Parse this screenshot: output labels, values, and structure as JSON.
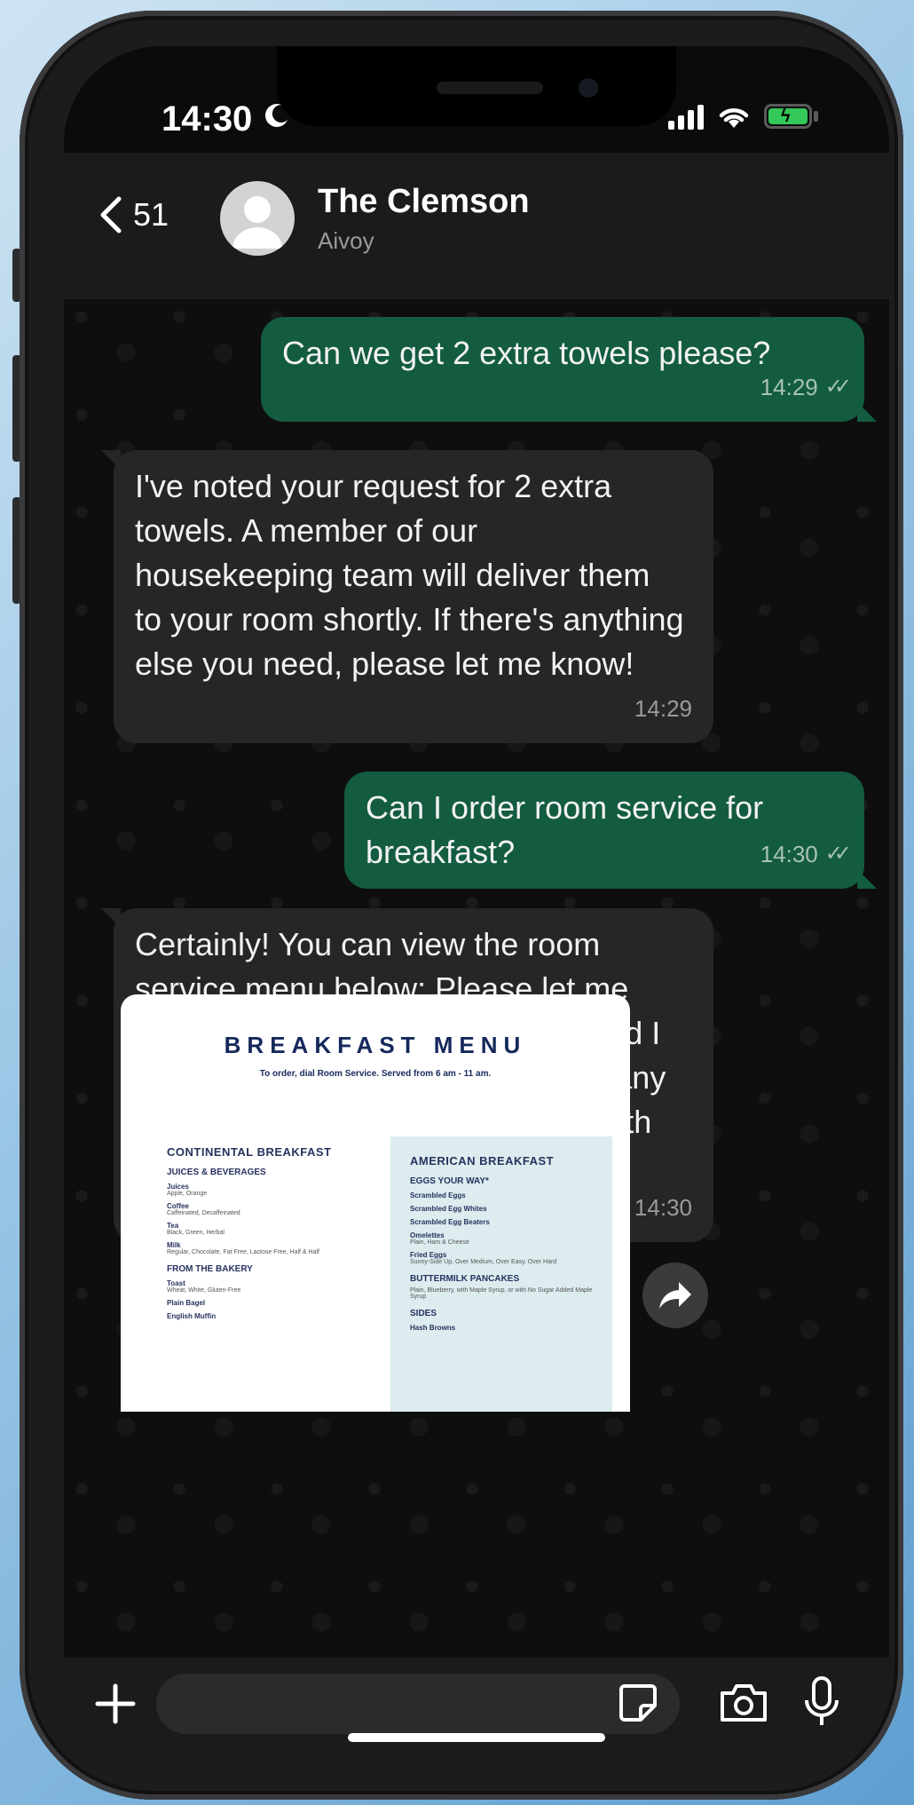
{
  "status": {
    "time": "14:30"
  },
  "header": {
    "back_count": "51",
    "name": "The Clemson",
    "subtitle": "Aivoy"
  },
  "messages": [
    {
      "dir": "out",
      "text": "Can we get 2 extra towels please?",
      "time": "14:29"
    },
    {
      "dir": "in",
      "text": "I've noted your request for 2 extra towels. A member of our housekeeping team will deliver them to your room shortly. If there's anything else you need, please let me know!",
      "time": "14:29"
    },
    {
      "dir": "out",
      "text": "Can I order room service for breakfast?",
      "time": "14:30"
    },
    {
      "dir": "in",
      "text": "Certainly! You can view the room service menu below: Please let me know your breakfast selections, and I will arrange it for you. If you need any recommendations or assistance with your order, feel free to ask!",
      "time": "14:30"
    }
  ],
  "menu": {
    "title": "BREAKFAST MENU",
    "subtitle": "To order, dial Room Service. Served from 6 am - 11 am.",
    "left": {
      "heading": "CONTINENTAL BREAKFAST",
      "sub1": "JUICES & BEVERAGES",
      "items1": [
        {
          "name": "Juices",
          "desc": "Apple, Orange"
        },
        {
          "name": "Coffee",
          "desc": "Caffeinated, Decaffeinated"
        },
        {
          "name": "Tea",
          "desc": "Black, Green, Herbal"
        },
        {
          "name": "Milk",
          "desc": "Regular, Chocolate, Fat Free, Lactose Free, Half & Half"
        }
      ],
      "sub2": "FROM THE BAKERY",
      "items2": [
        {
          "name": "Toast",
          "desc": "Wheat, White, Gluten-Free"
        },
        {
          "name": "Plain Bagel",
          "desc": ""
        },
        {
          "name": "English Muffin",
          "desc": ""
        }
      ]
    },
    "right": {
      "heading": "AMERICAN BREAKFAST",
      "sub1": "EGGS YOUR WAY*",
      "items1": [
        {
          "name": "Scrambled Eggs",
          "desc": ""
        },
        {
          "name": "Scrambled Egg Whites",
          "desc": ""
        },
        {
          "name": "Scrambled Egg Beaters",
          "desc": ""
        },
        {
          "name": "Omelettes",
          "desc": "Plain, Ham & Cheese"
        },
        {
          "name": "Fried Eggs",
          "desc": "Sunny-Side Up, Over Medium, Over Easy, Over Hard"
        }
      ],
      "sub2": "BUTTERMILK PANCAKES",
      "sub2_desc": "Plain, Blueberry, with Maple Syrup, or with No Sugar Added Maple Syrup",
      "sub3": "SIDES",
      "items3": [
        {
          "name": "Hash Browns",
          "desc": ""
        }
      ]
    }
  },
  "input": {
    "placeholder": ""
  }
}
